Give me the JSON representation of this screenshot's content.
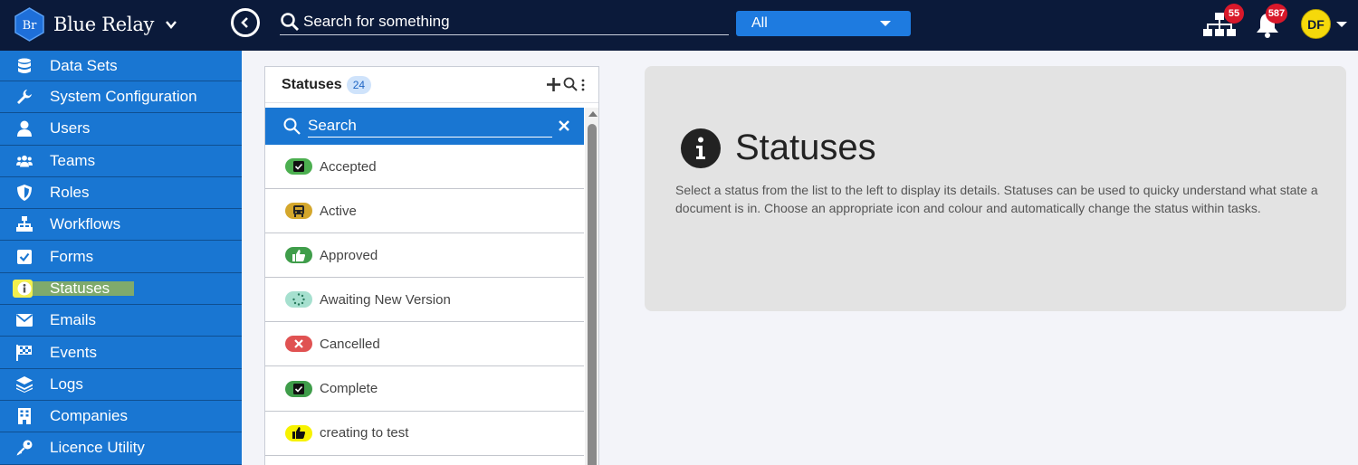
{
  "app": {
    "name": "Blue Relay",
    "logo_text": "Br"
  },
  "topbar": {
    "search_placeholder": "Search for something",
    "scope_value": "All",
    "hierarchy_count": "55",
    "notification_count": "587",
    "user_initials": "DF"
  },
  "sidebar": {
    "items": [
      {
        "label": "Data Sets",
        "icon": "database-icon"
      },
      {
        "label": "System Configuration",
        "icon": "wrench-icon"
      },
      {
        "label": "Users",
        "icon": "user-icon"
      },
      {
        "label": "Teams",
        "icon": "users-icon"
      },
      {
        "label": "Roles",
        "icon": "shield-icon"
      },
      {
        "label": "Workflows",
        "icon": "sitemap-icon"
      },
      {
        "label": "Forms",
        "icon": "check-square-icon"
      },
      {
        "label": "Statuses",
        "icon": "info-icon",
        "active": true
      },
      {
        "label": "Emails",
        "icon": "envelope-icon"
      },
      {
        "label": "Events",
        "icon": "flag-checkered-icon"
      },
      {
        "label": "Logs",
        "icon": "layers-icon"
      },
      {
        "label": "Companies",
        "icon": "building-icon"
      },
      {
        "label": "Licence Utility",
        "icon": "key-icon"
      }
    ]
  },
  "list": {
    "title": "Statuses",
    "count": "24",
    "search_placeholder": "Search",
    "items": [
      {
        "label": "Accepted",
        "icon": "check-square-icon",
        "color": "#4caf50"
      },
      {
        "label": "Active",
        "icon": "bus-icon",
        "color": "#d4a72c"
      },
      {
        "label": "Approved",
        "icon": "thumbs-up-icon",
        "color": "#3f9d4a"
      },
      {
        "label": "Awaiting New Version",
        "icon": "spinner-icon",
        "color": "#a6e0cf"
      },
      {
        "label": "Cancelled",
        "icon": "times-icon",
        "color": "#e05252"
      },
      {
        "label": "Complete",
        "icon": "check-square-icon",
        "color": "#3f9d4a"
      },
      {
        "label": "creating to test",
        "icon": "thumbs-up-icon",
        "color": "#f7f200"
      }
    ]
  },
  "detail": {
    "title": "Statuses",
    "description": "Select a status from the list to the left to display its details. Statuses can be used to quicky understand what state a document is in. Choose an appropriate icon and colour and automatically change the status within tasks."
  }
}
